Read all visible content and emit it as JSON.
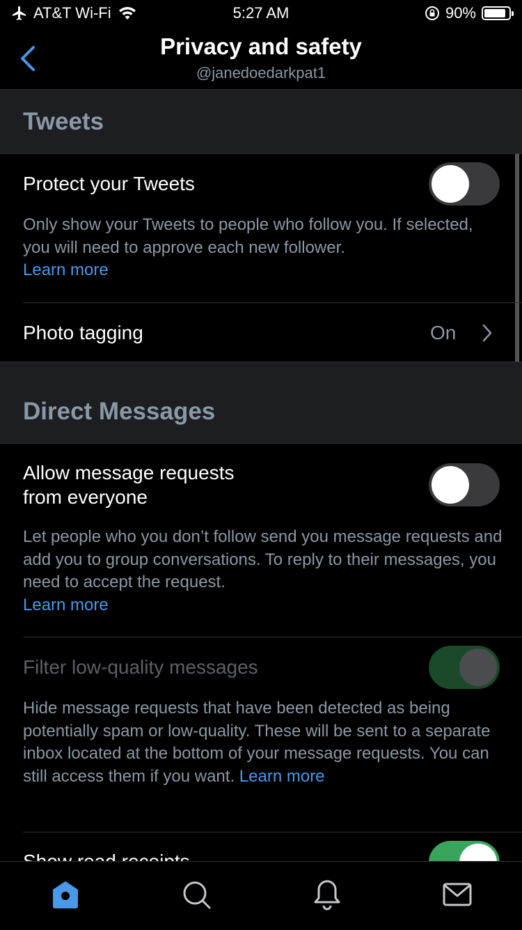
{
  "status_bar": {
    "carrier": "AT&T Wi-Fi",
    "time": "5:27 AM",
    "battery": "90%",
    "battery_level": 0.9
  },
  "header": {
    "title": "Privacy and safety",
    "subtitle": "@janedoedarkpat1",
    "back_icon": "chevron-left-icon"
  },
  "sections": {
    "tweets": {
      "title": "Tweets",
      "protect": {
        "label": "Protect your Tweets",
        "toggle": "off",
        "description": "Only show your Tweets to people who follow you. If selected, you will need to approve each new follower.",
        "link": "Learn more"
      },
      "photo_tagging": {
        "label": "Photo tagging",
        "value": "On"
      }
    },
    "dm": {
      "title": "Direct Messages",
      "allow_requests": {
        "label_line1": "Allow message requests",
        "label_line2": "from everyone",
        "toggle": "off",
        "description": "Let people who you don’t follow send you message requests and add you to group conversations. To reply to their messages, you need to accept the request.",
        "link": "Learn more"
      },
      "filter_low_quality": {
        "label": "Filter low-quality messages",
        "toggle": "on-disabled",
        "description": "Hide message requests that have been detected as being potentially spam or low-quality. These will be sent to a separate inbox located at the bottom of your message requests. You can still access them if you want.",
        "link": "Learn more"
      },
      "read_receipts": {
        "label": "Show read receipts",
        "toggle": "on"
      }
    }
  },
  "tab_bar": {
    "tabs": [
      "home-icon",
      "search-icon",
      "notifications-icon",
      "messages-icon"
    ],
    "active": "home-icon"
  },
  "colors": {
    "accent": "#4a99e9",
    "toggle_on": "#3aa45c",
    "background": "#000000",
    "section_bg": "#1c1e22"
  }
}
